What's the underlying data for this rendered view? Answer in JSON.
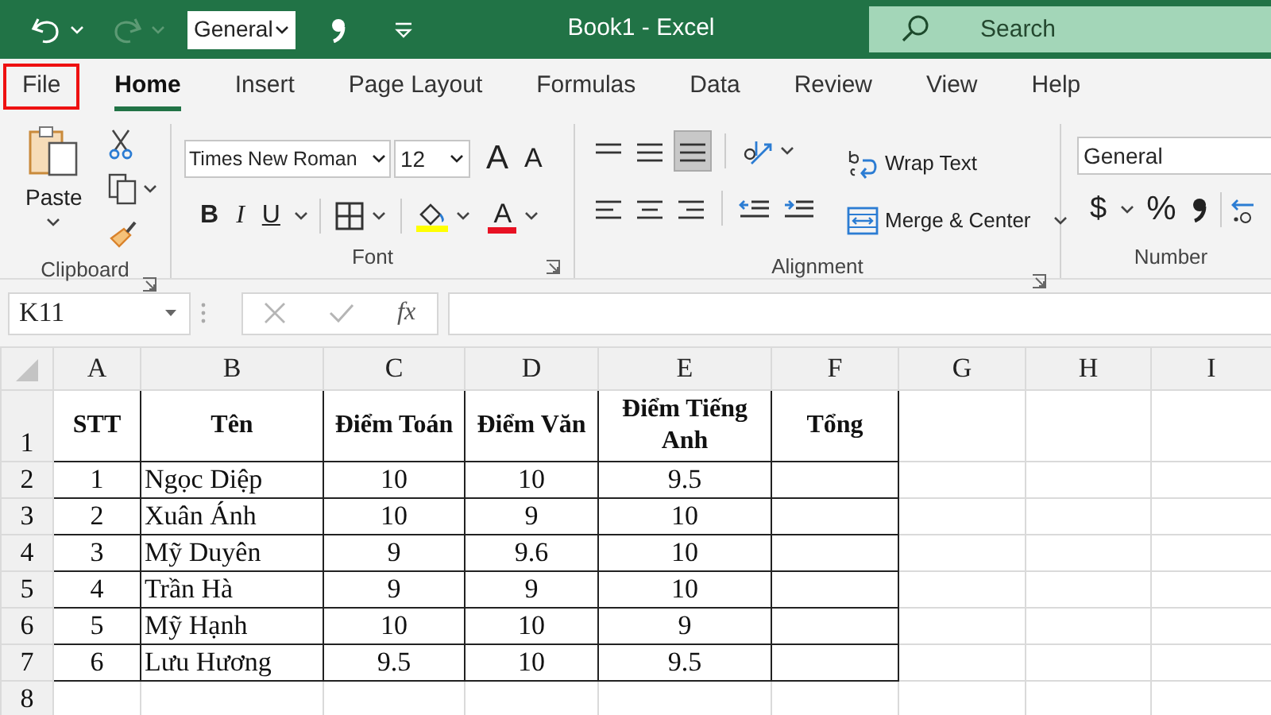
{
  "title_bar": {
    "number_format": "General",
    "title": "Book1  -  Excel",
    "search": {
      "placeholder": "Search"
    }
  },
  "ribbon_tabs": [
    {
      "label": "File",
      "selected": false,
      "outlined": true
    },
    {
      "label": "Home",
      "selected": true,
      "outlined": false
    },
    {
      "label": "Insert",
      "selected": false,
      "outlined": false
    },
    {
      "label": "Page Layout",
      "selected": false,
      "outlined": false
    },
    {
      "label": "Formulas",
      "selected": false,
      "outlined": false
    },
    {
      "label": "Data",
      "selected": false,
      "outlined": false
    },
    {
      "label": "Review",
      "selected": false,
      "outlined": false
    },
    {
      "label": "View",
      "selected": false,
      "outlined": false
    },
    {
      "label": "Help",
      "selected": false,
      "outlined": false
    }
  ],
  "ribbon": {
    "clipboard": {
      "paste": "Paste",
      "label": "Clipboard"
    },
    "font": {
      "font_name": "Times New Roman",
      "font_size": "12",
      "grow": "A",
      "shrink": "A",
      "bold": "B",
      "italic": "I",
      "underline": "U",
      "font_color": "A",
      "label": "Font"
    },
    "alignment": {
      "vertical": [
        {
          "selected": false
        },
        {
          "selected": false
        },
        {
          "selected": true
        }
      ],
      "wrap_text": "Wrap Text",
      "merge": "Merge & Center",
      "label": "Alignment"
    },
    "number": {
      "format": "General",
      "currency": "$",
      "percent": "%",
      "label": "Number"
    }
  },
  "formula_bar": {
    "name_box": "K11",
    "function": "fx"
  },
  "sheet": {
    "columns": [
      {
        "label": "A",
        "kind": "number"
      },
      {
        "label": "B",
        "kind": "text"
      },
      {
        "label": "C",
        "kind": "number"
      },
      {
        "label": "D",
        "kind": "number"
      },
      {
        "label": "E",
        "kind": "number"
      },
      {
        "label": "F",
        "kind": "number"
      },
      {
        "label": "G"
      },
      {
        "label": "H"
      },
      {
        "label": "I"
      }
    ],
    "rows": [
      {
        "header": "1",
        "kind": "heading",
        "cells": [
          "STT",
          "Tên",
          "Điểm Toán",
          "Điểm Văn",
          "Điểm Tiếng Anh",
          "Tổng"
        ]
      },
      {
        "header": "2",
        "kind": "data",
        "cells": [
          "1",
          "Ngọc Diệp",
          "10",
          "10",
          "9.5",
          ""
        ]
      },
      {
        "header": "3",
        "kind": "data",
        "cells": [
          "2",
          "Xuân Ánh",
          "10",
          "9",
          "10",
          ""
        ]
      },
      {
        "header": "4",
        "kind": "data",
        "cells": [
          "3",
          "Mỹ Duyên",
          "9",
          "9.6",
          "10",
          ""
        ]
      },
      {
        "header": "5",
        "kind": "data",
        "cells": [
          "4",
          "Trần Hà",
          "9",
          "9",
          "10",
          ""
        ]
      },
      {
        "header": "6",
        "kind": "data",
        "cells": [
          "5",
          "Mỹ Hạnh",
          "10",
          "10",
          "9",
          ""
        ]
      },
      {
        "header": "7",
        "kind": "data",
        "cells": [
          "6",
          "Lưu Hương",
          "9.5",
          "10",
          "9.5",
          ""
        ]
      },
      {
        "header": "8",
        "kind": "data"
      }
    ]
  }
}
